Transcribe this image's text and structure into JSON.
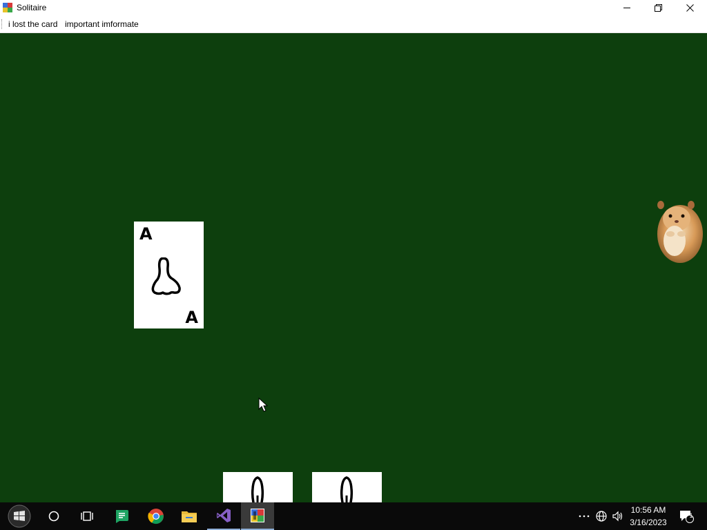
{
  "window": {
    "title": "Solitaire",
    "controls": {
      "minimize": "minimize-icon",
      "maximize": "restore-icon",
      "close": "close-icon"
    }
  },
  "menu": {
    "items": [
      {
        "label": "i lost the card"
      },
      {
        "label": "important imformate"
      }
    ]
  },
  "table": {
    "background": "#0d3f0d",
    "cards": [
      {
        "rank": "A",
        "face": "nose-drawing",
        "position": "center-left"
      },
      {
        "face": "nose-drawing",
        "partially_visible": true
      },
      {
        "face": "nose-drawing",
        "partially_visible": true
      }
    ],
    "decoration": "hamster-image"
  },
  "taskbar": {
    "icons": [
      "windows-start-icon",
      "cortana-circle-icon",
      "task-view-icon",
      "green-chat-app-icon",
      "chrome-icon",
      "file-explorer-icon",
      "visual-studio-icon",
      "solitaire-app-icon"
    ],
    "tray": [
      "overflow-dots-icon",
      "network-globe-icon",
      "volume-icon",
      "notification-icon"
    ],
    "time": "10:56 AM",
    "date": "3/16/2023",
    "notification_count": "1"
  }
}
